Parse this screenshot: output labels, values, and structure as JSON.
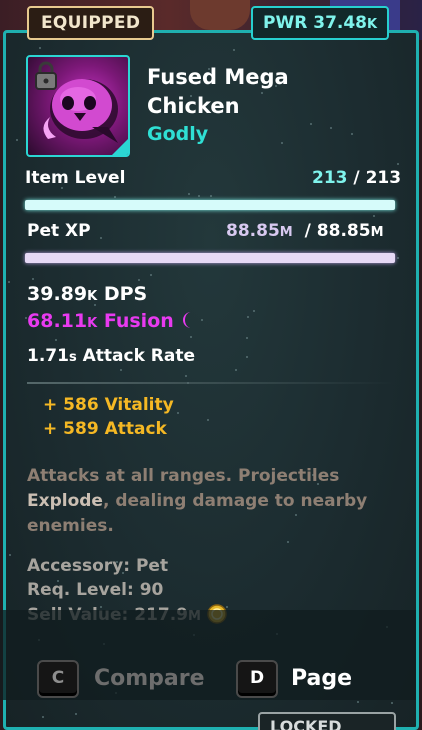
{
  "tags": {
    "equipped": "EQUIPPED",
    "power_label": "PWR",
    "power_value": "37.48",
    "power_suffix": "K"
  },
  "item": {
    "name": "Fused Mega Chicken",
    "rarity": "Godly"
  },
  "item_level": {
    "label": "Item Level",
    "current": "213",
    "separator": "/",
    "max": "213",
    "fill": 1.0
  },
  "pet_xp": {
    "label": "Pet XP",
    "current": "88.85",
    "current_suffix": "M",
    "separator": "/",
    "max": "88.85",
    "max_suffix": "M",
    "fill": 1.0
  },
  "combat": {
    "dps_value": "39.89",
    "dps_suffix": "K",
    "dps_label": "DPS",
    "fusion_value": "68.11",
    "fusion_suffix": "K",
    "fusion_label": "Fusion",
    "rate_value": "1.71",
    "rate_suffix": "s",
    "rate_label": "Attack Rate"
  },
  "stats": [
    "+ 586 Vitality",
    "+ 589 Attack"
  ],
  "description": {
    "part1": "Attacks at all ranges. Projectiles",
    "highlight": "Explode",
    "part2": ", dealing damage to nearby enemies."
  },
  "meta": {
    "type_label": "Accessory:",
    "type_value": "Pet",
    "req_label": "Req. Level:",
    "req_value": "90",
    "sell_label": "Sell Value:",
    "sell_value": "217.9",
    "sell_suffix": "M"
  },
  "footer": {
    "compare_key": "C",
    "compare_label": "Compare",
    "page_key": "D",
    "page_label": "Page"
  },
  "lock_tag": "LOCKED",
  "colors": {
    "accent": "#1fb0b0",
    "rarity": "#2fe0d4",
    "fusion": "#e83af0",
    "stat": "#f5b824",
    "xp_bar": "#e6d9f5",
    "level_bar": "#d6fbfa"
  },
  "icons": {
    "lock": "padlock-icon",
    "moon": "crescent-moon-icon",
    "coin": "gold-coin-icon"
  }
}
